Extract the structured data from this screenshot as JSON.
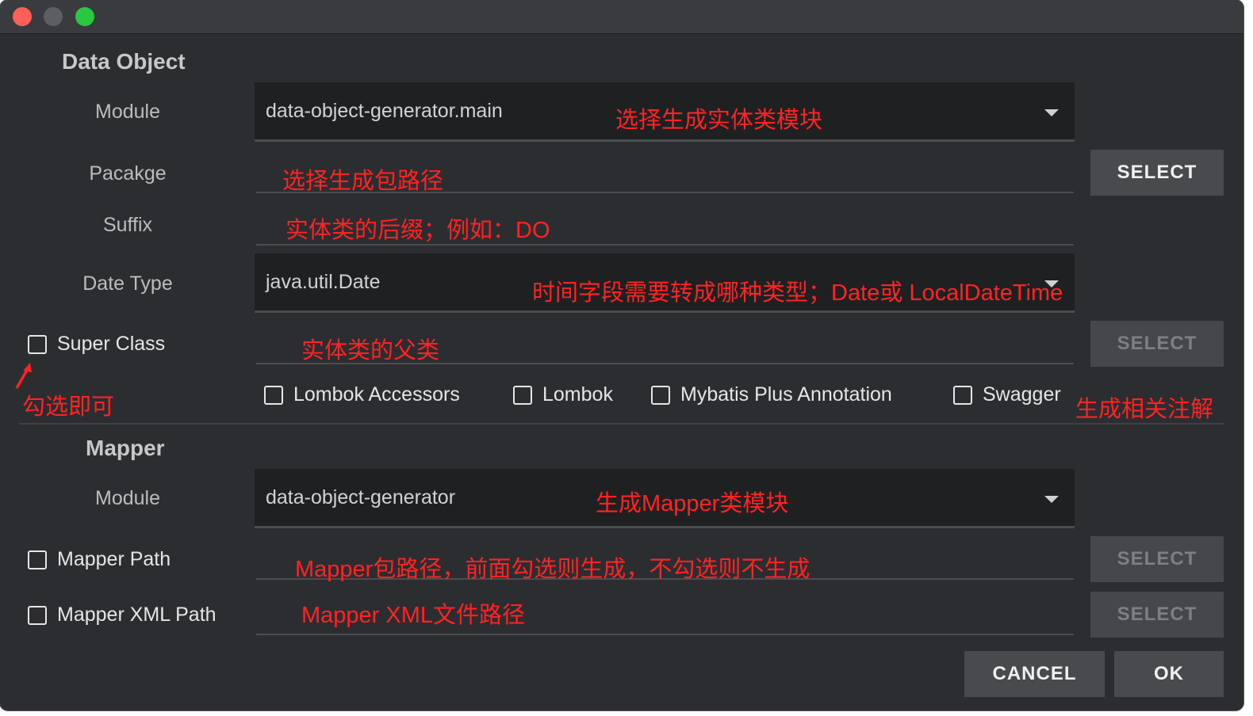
{
  "data_object": {
    "title": "Data Object",
    "module_label": "Module",
    "module_value": "data-object-generator.main",
    "package_label": "Pacakge",
    "suffix_label": "Suffix",
    "date_type_label": "Date Type",
    "date_type_value": "java.util.Date",
    "super_class_label": "Super Class",
    "select_label": "SELECT",
    "options": [
      "Lombok Accessors",
      "Lombok",
      "Mybatis Plus Annotation",
      "Swagger"
    ]
  },
  "mapper": {
    "title": "Mapper",
    "module_label": "Module",
    "module_value": "data-object-generator",
    "path_label": "Mapper Path",
    "xml_path_label": "Mapper XML Path",
    "select_label": "SELECT"
  },
  "footer": {
    "cancel_label": "CANCEL",
    "ok_label": "OK"
  },
  "annotations": {
    "module": "选择生成实体类模块",
    "package": "选择生成包路径",
    "suffix": "实体类的后缀；例如：DO",
    "date_type": "时间字段需要转成哪种类型；Date或 LocalDateTime",
    "super_class": "实体类的父类",
    "check_hint": "勾选即可",
    "options": "生成相关注解",
    "mapper_module": "生成Mapper类模块",
    "mapper_path": "Mapper包路径，前面勾选则生成，不勾选则不生成",
    "mapper_xml": "Mapper XML文件路径"
  },
  "colors": {
    "window_bg": "#2b2d30",
    "annotation": "#ff2323",
    "button_bg": "#484a4e"
  }
}
